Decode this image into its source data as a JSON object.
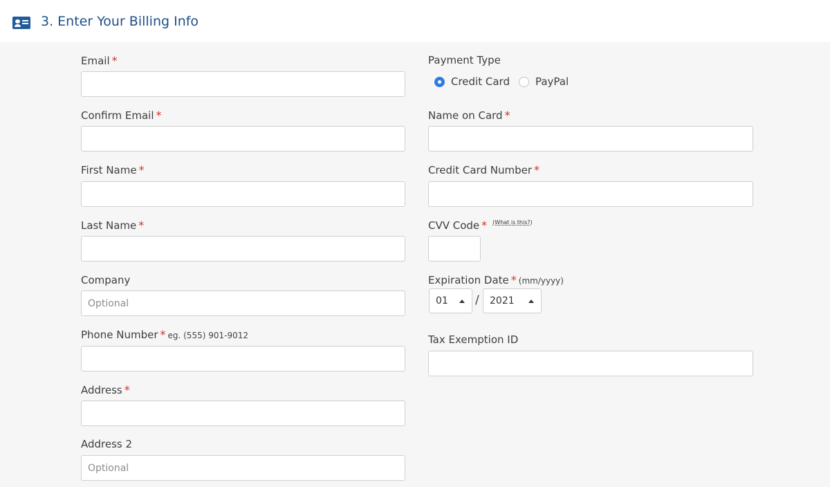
{
  "header": {
    "title": "3. Enter Your Billing Info",
    "icon": "id-card-icon"
  },
  "required_mark": "*",
  "left": {
    "email": {
      "label": "Email",
      "value": ""
    },
    "confirm_email": {
      "label": "Confirm Email",
      "value": ""
    },
    "first_name": {
      "label": "First Name",
      "value": ""
    },
    "last_name": {
      "label": "Last Name",
      "value": ""
    },
    "company": {
      "label": "Company",
      "placeholder": "Optional",
      "value": ""
    },
    "phone": {
      "label": "Phone Number",
      "hint": "eg. (555) 901-9012",
      "value": ""
    },
    "address": {
      "label": "Address",
      "value": ""
    },
    "address2": {
      "label": "Address 2",
      "placeholder": "Optional",
      "value": ""
    }
  },
  "right": {
    "payment_type": {
      "label": "Payment Type",
      "options": [
        "Credit Card",
        "PayPal"
      ],
      "selected": "Credit Card"
    },
    "name_on_card": {
      "label": "Name on Card",
      "value": ""
    },
    "card_number": {
      "label": "Credit Card Number",
      "value": ""
    },
    "cvv": {
      "label": "CVV Code",
      "help_link": "(What is this?)",
      "value": ""
    },
    "expiration": {
      "label": "Expiration Date",
      "format_hint": "(mm/yyyy)",
      "month": "01",
      "year": "2021",
      "separator": "/"
    },
    "tax_id": {
      "label": "Tax Exemption ID",
      "value": ""
    }
  },
  "colors": {
    "accent": "#1f4f86",
    "required": "#d0302a",
    "radio_selected": "#2f7de1",
    "panel_bg": "#f6f6f6"
  }
}
